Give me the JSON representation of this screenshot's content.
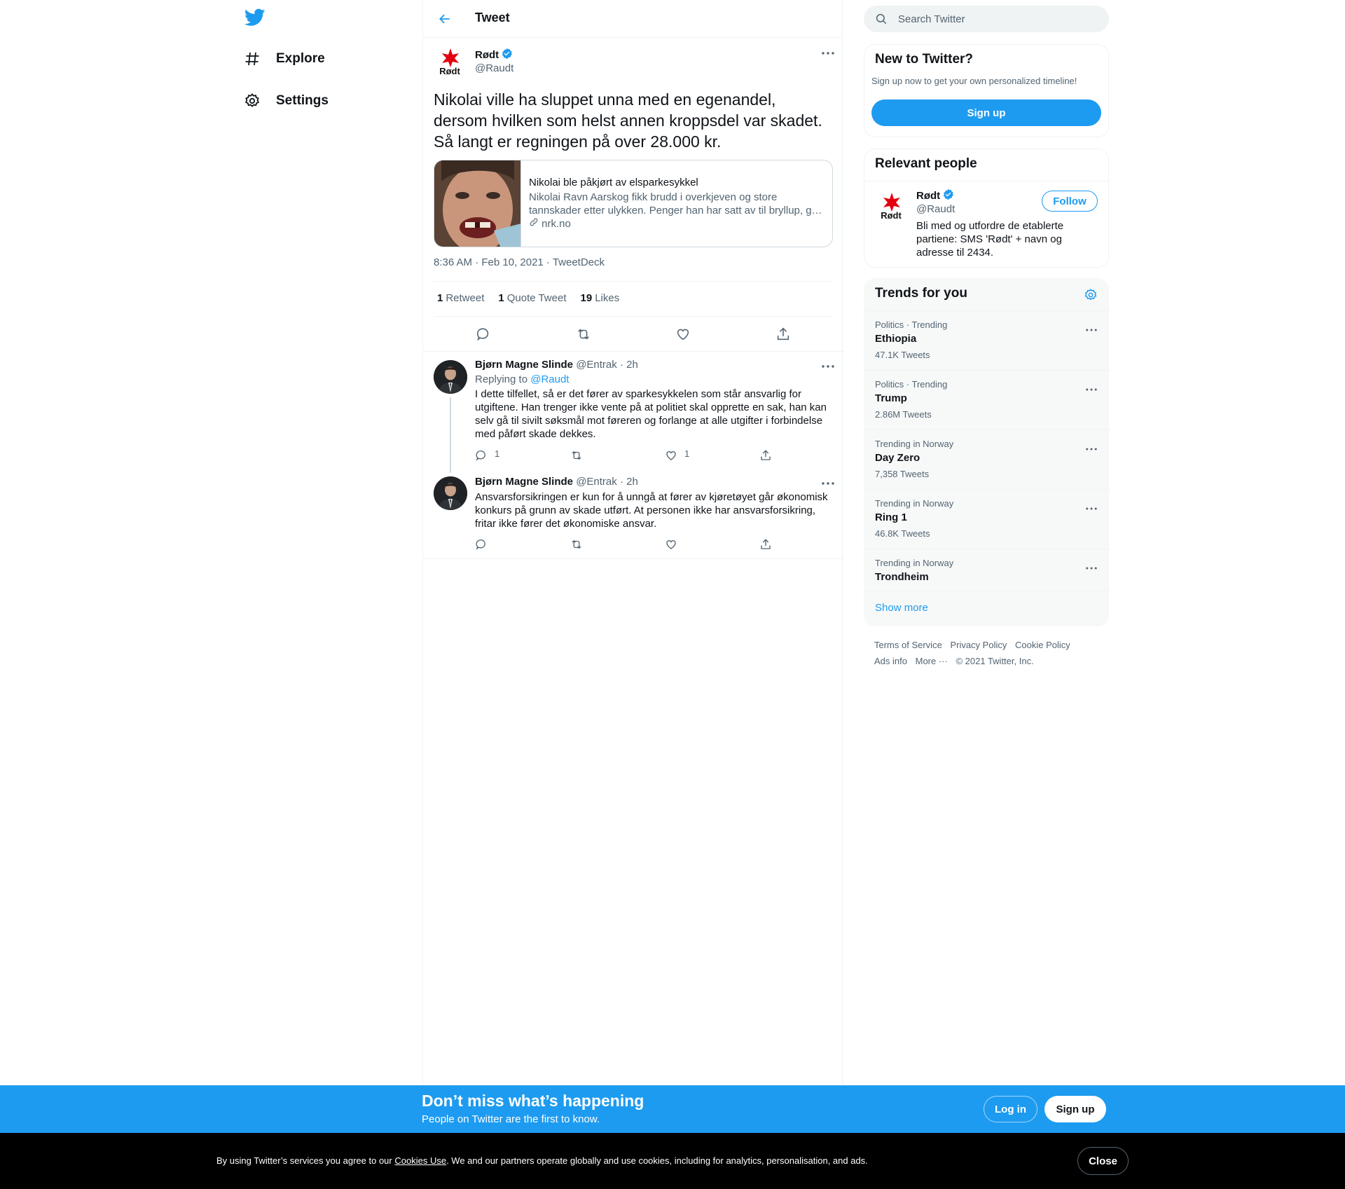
{
  "nav": {
    "logo_icon": "twitter-bird-icon",
    "items": [
      {
        "label": "Explore",
        "icon": "hashtag-icon"
      },
      {
        "label": "Settings",
        "icon": "gear-icon"
      }
    ]
  },
  "header": {
    "title": "Tweet",
    "back_icon": "arrow-left-icon"
  },
  "tweet": {
    "name": "Rødt",
    "handle": "@Raudt",
    "avatar_text": "Rødt",
    "text": "Nikolai ville ha sluppet unna med en egenandel, dersom hvilken som helst annen kroppsdel var skadet. Så langt er regningen på over 28.000 kr.",
    "card": {
      "title": "Nikolai ble påkjørt av elsparkesykkel",
      "description": "Nikolai Ravn Aarskog fikk brudd i overkjeven og store tannskader etter ulykken. Penger han har satt av til bryllup, g…",
      "domain": "nrk.no"
    },
    "timestamp": "8:36 AM · Feb 10, 2021 · TweetDeck",
    "stats": {
      "retweets_count": "1",
      "retweets_label": "Retweet",
      "quotes_count": "1",
      "quotes_label": "Quote Tweet",
      "likes_count": "19",
      "likes_label": "Likes"
    }
  },
  "replies": [
    {
      "name": "Bjørn Magne Slinde",
      "handle": "@Entrak",
      "time": "· 2h",
      "replying_prefix": "Replying to",
      "replying_to": "@Raudt",
      "text": "I dette tilfellet, så er det fører av sparkesykkelen som står ansvarlig for utgiftene. Han trenger ikke vente på at politiet skal opprette en sak, han kan selv gå til sivilt søksmål mot føreren og forlange at alle utgifter i forbindelse med påført skade dekkes.",
      "reply_count": "1",
      "like_count": "1"
    },
    {
      "name": "Bjørn Magne Slinde",
      "handle": "@Entrak",
      "time": "· 2h",
      "text": "Ansvarsforsikringen er kun for å unngå at fører av kjøretøyet går økonomisk konkurs på grunn av skade utført. At personen ikke har ansvarsforsikring, fritar ikke fører det økonomiske ansvar."
    }
  ],
  "search": {
    "placeholder": "Search Twitter"
  },
  "new_to_twitter": {
    "title": "New to Twitter?",
    "subtitle": "Sign up now to get your own personalized timeline!",
    "button": "Sign up"
  },
  "relevant_people": {
    "title": "Relevant people",
    "name": "Rødt",
    "handle": "@Raudt",
    "bio": "Bli med og utfordre de etablerte partiene: SMS 'Rødt' + navn og adresse til 2434.",
    "follow": "Follow"
  },
  "trends": {
    "title": "Trends for you",
    "items": [
      {
        "context": "Politics · Trending",
        "name": "Ethiopia",
        "count": "47.1K Tweets"
      },
      {
        "context": "Politics · Trending",
        "name": "Trump",
        "count": "2.86M Tweets"
      },
      {
        "context": "Trending in Norway",
        "name": "Day Zero",
        "count": "7,358 Tweets"
      },
      {
        "context": "Trending in Norway",
        "name": "Ring 1",
        "count": "46.8K Tweets"
      },
      {
        "context": "Trending in Norway",
        "name": "Trondheim",
        "count": ""
      }
    ],
    "show_more": "Show more"
  },
  "footer": {
    "links": [
      "Terms of Service",
      "Privacy Policy",
      "Cookie Policy",
      "Ads info",
      "More ···"
    ],
    "copyright": "© 2021 Twitter, Inc."
  },
  "banner": {
    "title": "Don’t miss what’s happening",
    "subtitle": "People on Twitter are the first to know.",
    "login": "Log in",
    "signup": "Sign up"
  },
  "cookie": {
    "prefix": "By using Twitter’s services you agree to our ",
    "link": "Cookies Use",
    "suffix": ". We and our partners operate globally and use cookies, including for analytics, personalisation, and ads.",
    "close": "Close"
  },
  "colors": {
    "accent": "#1d9bf0",
    "text": "#0f1419",
    "secondary": "#536471",
    "rodt_red": "#e3000f"
  }
}
